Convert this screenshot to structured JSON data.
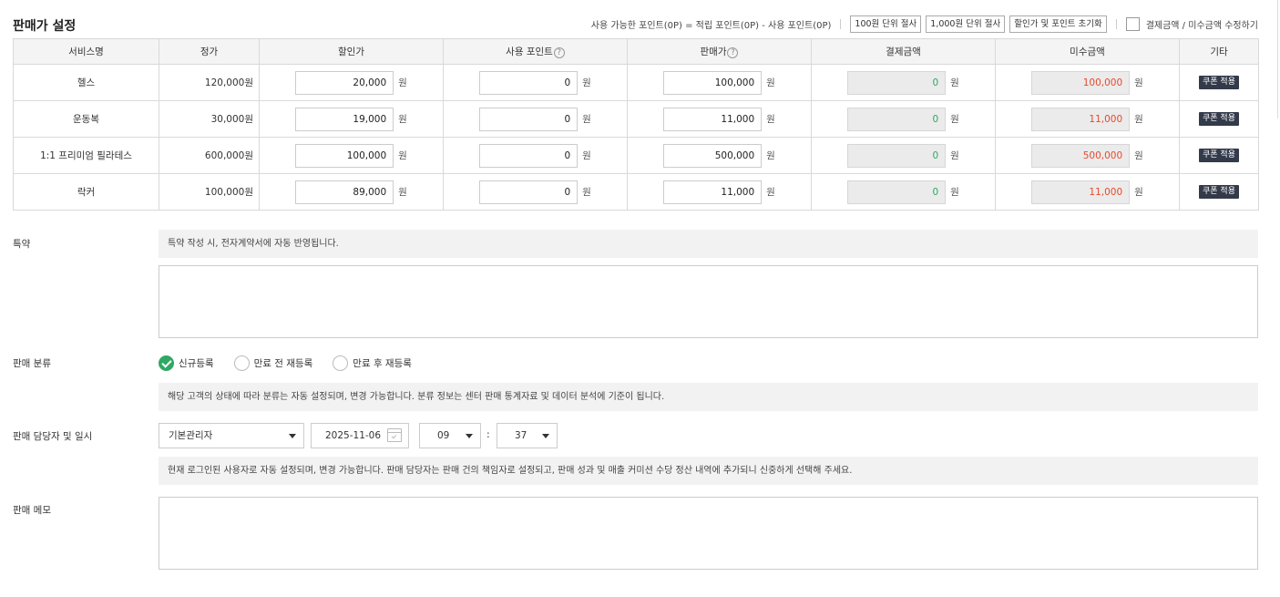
{
  "header": {
    "title": "판매가 설정",
    "formula": "사용 가능한 포인트(0P) = 적립 포인트(0P) - 사용 포인트(0P)",
    "buttons": [
      "100원 단위 절사",
      "1,000원 단위 절사",
      "할인가 및 포인트 초기화"
    ],
    "checkbox_label": "결제금액 / 미수금액 수정하기"
  },
  "table": {
    "columns": [
      "서비스명",
      "정가",
      "할인가",
      "사용 포인트",
      "판매가",
      "결제금액",
      "미수금액",
      "기타"
    ],
    "help_icon": "?",
    "unit": "원",
    "coupon_label": "쿠폰 적용",
    "rows": [
      {
        "service": "헬스",
        "list_price": "120,000원",
        "discount": "20,000",
        "points": "0",
        "sale": "100,000",
        "paid": "0",
        "unpaid": "100,000"
      },
      {
        "service": "운동복",
        "list_price": "30,000원",
        "discount": "19,000",
        "points": "0",
        "sale": "11,000",
        "paid": "0",
        "unpaid": "11,000"
      },
      {
        "service": "1:1 프리미엄 필라테스",
        "list_price": "600,000원",
        "discount": "100,000",
        "points": "0",
        "sale": "500,000",
        "paid": "0",
        "unpaid": "500,000"
      },
      {
        "service": "락커",
        "list_price": "100,000원",
        "discount": "89,000",
        "points": "0",
        "sale": "11,000",
        "paid": "0",
        "unpaid": "11,000"
      }
    ]
  },
  "terms": {
    "label": "특약",
    "info": "특약 작성 시, 전자계약서에 자동 반영됩니다."
  },
  "category": {
    "label": "판매 분류",
    "options": [
      "신규등록",
      "만료 전 재등록",
      "만료 후 재등록"
    ],
    "selected": "신규등록",
    "info": "해당 고객의 상태에 따라 분류는 자동 설정되며, 변경 가능합니다. 분류 정보는 센터 판매 통계자료 및 데이터 분석에 기준이 됩니다."
  },
  "manager": {
    "label": "판매 담당자 및 일시",
    "manager_value": "기본관리자",
    "date": "2025-11-06",
    "hour": "09",
    "minute": "37",
    "colon": ":",
    "info": "현재 로그인된 사용자로 자동 설정되며, 변경 가능합니다. 판매 담당자는 판매 건의 책임자로 설정되고, 판매 성과 및 매출 커미션 수당 정산 내역에 추가되니 신중하게 선택해 주세요."
  },
  "memo": {
    "label": "판매 메모"
  },
  "colors": {
    "paid_text": "#2fa863",
    "unpaid_text": "#e8492c",
    "radio_checked": "#2fa863",
    "coupon_bg": "#333a4a"
  }
}
